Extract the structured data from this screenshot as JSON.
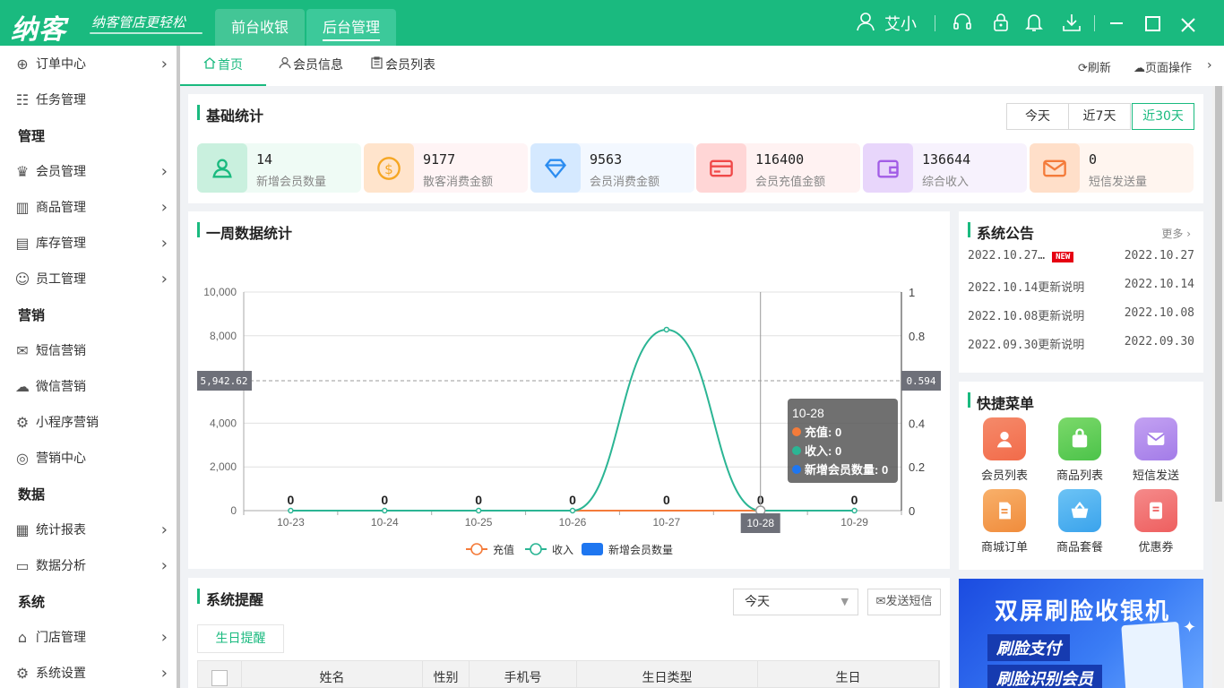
{
  "app": {
    "logo": "纳客",
    "slogan": "纳客管店更轻松",
    "nav": [
      "前台收银",
      "后台管理"
    ],
    "user": "艾小"
  },
  "sidebar": {
    "items": [
      {
        "label": "订单中心",
        "icon": "globe-icon",
        "arrow": true
      },
      {
        "label": "任务管理",
        "icon": "task-icon",
        "arrow": false
      },
      {
        "section": "管理"
      },
      {
        "label": "会员管理",
        "icon": "crown-icon",
        "arrow": true
      },
      {
        "label": "商品管理",
        "icon": "goods-icon",
        "arrow": true
      },
      {
        "label": "库存管理",
        "icon": "storage-icon",
        "arrow": true
      },
      {
        "label": "员工管理",
        "icon": "user-icon",
        "arrow": true
      },
      {
        "section": "营销"
      },
      {
        "label": "短信营销",
        "icon": "mail-icon",
        "arrow": false
      },
      {
        "label": "微信营销",
        "icon": "wechat-icon",
        "arrow": false
      },
      {
        "label": "小程序营销",
        "icon": "miniapp-icon",
        "arrow": false
      },
      {
        "label": "营销中心",
        "icon": "target-icon",
        "arrow": false
      },
      {
        "section": "数据"
      },
      {
        "label": "统计报表",
        "icon": "bar-icon",
        "arrow": true
      },
      {
        "label": "数据分析",
        "icon": "monitor-icon",
        "arrow": true
      },
      {
        "section": "系统"
      },
      {
        "label": "门店管理",
        "icon": "store-icon",
        "arrow": true
      },
      {
        "label": "系统设置",
        "icon": "gear-icon",
        "arrow": true
      }
    ]
  },
  "tabs": {
    "items": [
      "首页",
      "会员信息",
      "会员列表"
    ],
    "refresh": "刷新",
    "page_ops": "页面操作"
  },
  "basic_stats": {
    "title": "基础统计",
    "ranges": [
      "今天",
      "近7天",
      "近30天"
    ],
    "active_range": "近30天",
    "cards": [
      {
        "value": "14",
        "label": "新增会员数量",
        "bg": "#effbf5",
        "icon_bg": "#c9f0de",
        "color": "#1aba7f",
        "icon": "person-icon"
      },
      {
        "value": "9177",
        "label": "散客消费金额",
        "bg": "#fff4f5",
        "icon_bg": "#ffe4cc",
        "color": "#f5a623",
        "icon": "coin-icon"
      },
      {
        "value": "9563",
        "label": "会员消费金额",
        "bg": "#f3f8ff",
        "icon_bg": "#d5e9ff",
        "color": "#2b8cf0",
        "icon": "diamond-icon"
      },
      {
        "value": "116400",
        "label": "会员充值金额",
        "bg": "#fff2f2",
        "icon_bg": "#ffd6d6",
        "color": "#f04848",
        "icon": "card-icon"
      },
      {
        "value": "136644",
        "label": "综合收入",
        "bg": "#f7f2fd",
        "icon_bg": "#e8d6fb",
        "color": "#a25de6",
        "icon": "wallet-icon"
      },
      {
        "value": "0",
        "label": "短信发送量",
        "bg": "#fff5ef",
        "icon_bg": "#ffdfc9",
        "color": "#f47b3a",
        "icon": "envelope-icon"
      }
    ]
  },
  "weekly": {
    "title": "一周数据统计",
    "tooltip": {
      "date": "10-28",
      "lines": [
        "充值: 0",
        "收入: 0",
        "新增会员数量: 0"
      ]
    },
    "cursor_label": "5,942.62",
    "cursor_label_right": "0.594"
  },
  "chart_data": {
    "type": "line",
    "categories": [
      "10-23",
      "10-24",
      "10-25",
      "10-26",
      "10-27",
      "10-28",
      "10-29"
    ],
    "series": [
      {
        "name": "充值",
        "values": [
          0,
          0,
          0,
          0,
          0,
          0,
          0
        ],
        "color": "#f47b3a"
      },
      {
        "name": "收入",
        "values": [
          0,
          0,
          0,
          0,
          8280,
          0,
          0
        ],
        "color": "#2bb594"
      },
      {
        "name": "新增会员数量",
        "values": [
          0,
          0,
          0,
          0,
          0,
          0,
          0
        ],
        "color": "#1e76f0",
        "type": "bar"
      }
    ],
    "bar_labels": [
      "0",
      "0",
      "0",
      "0",
      "0",
      "0",
      "0"
    ],
    "y_left": {
      "min": 0,
      "max": 10000,
      "ticks": [
        "0",
        "2,000",
        "4,000",
        "8,000",
        "10,000"
      ]
    },
    "y_right": {
      "min": 0,
      "max": 1,
      "ticks": [
        "0",
        "0.2",
        "0.4",
        "0.8",
        "1"
      ]
    },
    "legend": "bottom"
  },
  "announcements": {
    "title": "系统公告",
    "more": "更多",
    "new_badge": "NEW",
    "items": [
      {
        "title": "2022.10.27…",
        "date": "2022.10.27",
        "new": true
      },
      {
        "title": "2022.10.14更新说明",
        "date": "2022.10.14"
      },
      {
        "title": "2022.10.08更新说明",
        "date": "2022.10.08"
      },
      {
        "title": "2022.09.30更新说明",
        "date": "2022.09.30"
      }
    ]
  },
  "quick_menu": {
    "title": "快捷菜单",
    "items": [
      {
        "label": "会员列表",
        "color": "#f58a6a",
        "color2": "#f26b4a",
        "icon": "member-icon"
      },
      {
        "label": "商品列表",
        "color": "#7bd96a",
        "color2": "#4cc34a",
        "icon": "bag-icon"
      },
      {
        "label": "短信发送",
        "color": "#c3a1f2",
        "color2": "#a37ce8",
        "icon": "sms-icon"
      },
      {
        "label": "商城订单",
        "color": "#f8b06a",
        "color2": "#f08c3c",
        "icon": "order-icon"
      },
      {
        "label": "商品套餐",
        "color": "#6cc3f5",
        "color2": "#3aa3ec",
        "icon": "basket-icon"
      },
      {
        "label": "优惠券",
        "color": "#f58a8a",
        "color2": "#ee5f5f",
        "icon": "coupon-icon"
      }
    ]
  },
  "banner": {
    "title": "双屏刷脸收银机",
    "lines": [
      "刷脸支付",
      "刷脸识别会员"
    ]
  },
  "reminders": {
    "title": "系统提醒",
    "select_value": "今天",
    "send_sms": "发送短信",
    "birthday_tab": "生日提醒",
    "columns": [
      "姓名",
      "性别",
      "手机号",
      "生日类型",
      "生日"
    ]
  }
}
